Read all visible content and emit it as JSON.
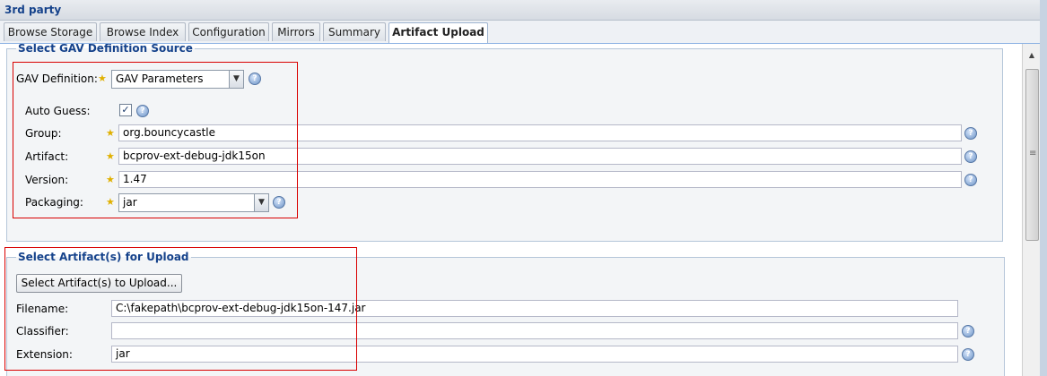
{
  "panel_title": "3rd party",
  "tabs": [
    {
      "label": "Browse Storage"
    },
    {
      "label": "Browse Index"
    },
    {
      "label": "Configuration"
    },
    {
      "label": "Mirrors"
    },
    {
      "label": "Summary"
    },
    {
      "label": "Artifact Upload",
      "active": true
    }
  ],
  "gav_section": {
    "legend": "Select GAV Definition Source",
    "gav_definition": {
      "label": "GAV Definition:",
      "value": "GAV Parameters"
    },
    "auto_guess": {
      "label": "Auto Guess:",
      "checked": true,
      "mark": "✓"
    },
    "group": {
      "label": "Group:",
      "value": "org.bouncycastle"
    },
    "artifact": {
      "label": "Artifact:",
      "value": "bcprov-ext-debug-jdk15on"
    },
    "version": {
      "label": "Version:",
      "value": "1.47"
    },
    "packaging": {
      "label": "Packaging:",
      "value": "jar"
    }
  },
  "upload_section": {
    "legend": "Select Artifact(s) for Upload",
    "select_button": "Select Artifact(s) to Upload...",
    "filename": {
      "label": "Filename:",
      "value": "C:\\fakepath\\bcprov-ext-debug-jdk15on-147.jar"
    },
    "classifier": {
      "label": "Classifier:",
      "value": ""
    },
    "extension": {
      "label": "Extension:",
      "value": "jar"
    }
  },
  "symbols": {
    "required": "★",
    "help": "?",
    "dropdown": "▼",
    "scroll_up": "▲",
    "grip": "≡"
  },
  "colors": {
    "accent": "#15428b",
    "highlight_border": "#d90000",
    "required_star": "#e0b000"
  },
  "icons": [
    "help-icon",
    "required-star-icon",
    "chevron-down-icon",
    "checkbox",
    "scroll-up-icon"
  ]
}
